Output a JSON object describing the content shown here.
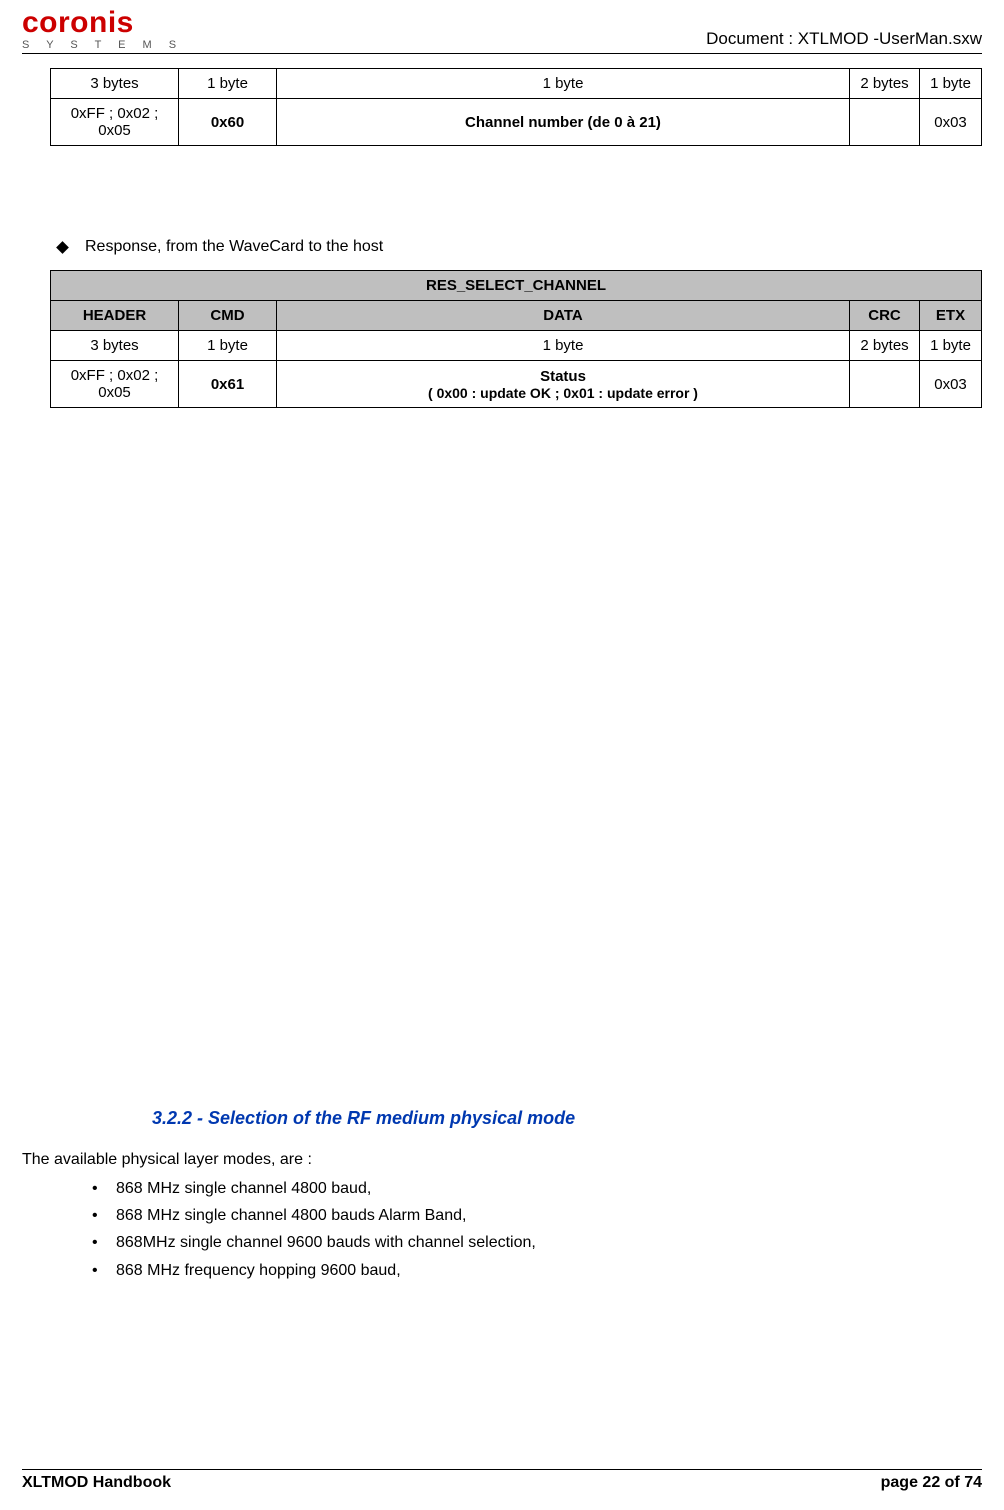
{
  "header": {
    "logo_main": "coronis",
    "logo_sub": "S Y S T E M S",
    "doc_label": "Document : XTLMOD -UserMan.sxw"
  },
  "table1": {
    "sizes": [
      "3 bytes",
      "1 byte",
      "1 byte",
      "2 bytes",
      "1 byte"
    ],
    "values": {
      "header": "0xFF ; 0x02 ; 0x05",
      "cmd": "0x60",
      "data": "Channel number (de 0 à 21)",
      "crc": "",
      "etx": "0x03"
    }
  },
  "response_label": "Response, from the WaveCard to the host",
  "table2": {
    "title": "RES_SELECT_CHANNEL",
    "cols": [
      "HEADER",
      "CMD",
      "DATA",
      "CRC",
      "ETX"
    ],
    "sizes": [
      "3 bytes",
      "1 byte",
      "1 byte",
      "2 bytes",
      "1 byte"
    ],
    "values": {
      "header": "0xFF ; 0x02 ; 0x05",
      "cmd": "0x61",
      "data_l1": "Status",
      "data_l2": "( 0x00 : update OK ; 0x01 : update error )",
      "crc": "",
      "etx": "0x03"
    }
  },
  "section": {
    "heading": "3.2.2 - Selection of the RF medium  physical mode",
    "intro": "The available physical layer modes, are :",
    "items": [
      "868 MHz  single channel  4800 baud,",
      "868 MHz single channel 4800 bauds Alarm Band,",
      "868MHz single channel  9600 bauds with channel selection,",
      "868 MHz frequency hopping 9600 baud,"
    ]
  },
  "footer": {
    "left": "XLTMOD Handbook",
    "right": "page 22 of 74"
  }
}
